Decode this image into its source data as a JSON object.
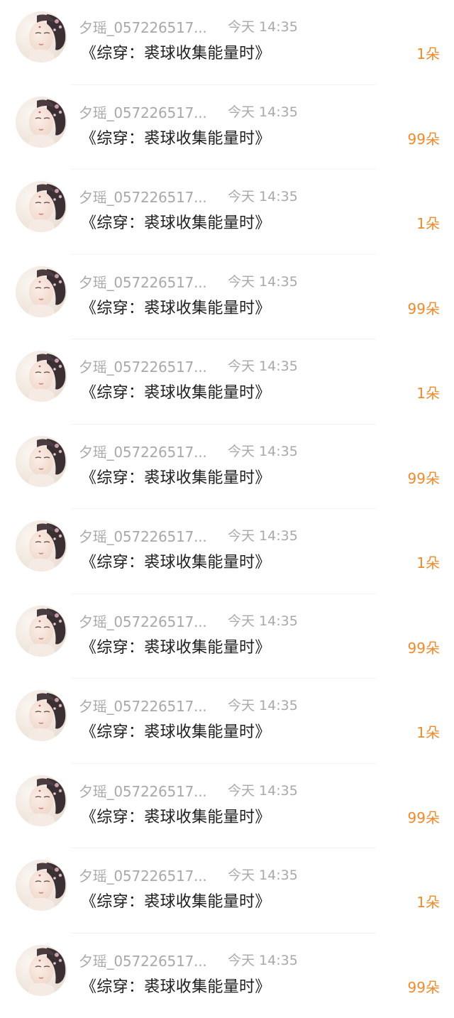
{
  "accent_color": "#f08a2a",
  "items": [
    {
      "user": "夕瑶_057226517...",
      "time": "今天 14:35",
      "book": "《综穿：裘球收集能量时》",
      "gift": "1朵"
    },
    {
      "user": "夕瑶_057226517...",
      "time": "今天 14:35",
      "book": "《综穿：裘球收集能量时》",
      "gift": "99朵"
    },
    {
      "user": "夕瑶_057226517...",
      "time": "今天 14:35",
      "book": "《综穿：裘球收集能量时》",
      "gift": "1朵"
    },
    {
      "user": "夕瑶_057226517...",
      "time": "今天 14:35",
      "book": "《综穿：裘球收集能量时》",
      "gift": "99朵"
    },
    {
      "user": "夕瑶_057226517...",
      "time": "今天 14:35",
      "book": "《综穿：裘球收集能量时》",
      "gift": "1朵"
    },
    {
      "user": "夕瑶_057226517...",
      "time": "今天 14:35",
      "book": "《综穿：裘球收集能量时》",
      "gift": "99朵"
    },
    {
      "user": "夕瑶_057226517...",
      "time": "今天 14:35",
      "book": "《综穿：裘球收集能量时》",
      "gift": "1朵"
    },
    {
      "user": "夕瑶_057226517...",
      "time": "今天 14:35",
      "book": "《综穿：裘球收集能量时》",
      "gift": "99朵"
    },
    {
      "user": "夕瑶_057226517...",
      "time": "今天 14:35",
      "book": "《综穿：裘球收集能量时》",
      "gift": "1朵"
    },
    {
      "user": "夕瑶_057226517...",
      "time": "今天 14:35",
      "book": "《综穿：裘球收集能量时》",
      "gift": "99朵"
    },
    {
      "user": "夕瑶_057226517...",
      "time": "今天 14:35",
      "book": "《综穿：裘球收集能量时》",
      "gift": "1朵"
    },
    {
      "user": "夕瑶_057226517...",
      "time": "今天 14:35",
      "book": "《综穿：裘球收集能量时》",
      "gift": "99朵"
    }
  ]
}
